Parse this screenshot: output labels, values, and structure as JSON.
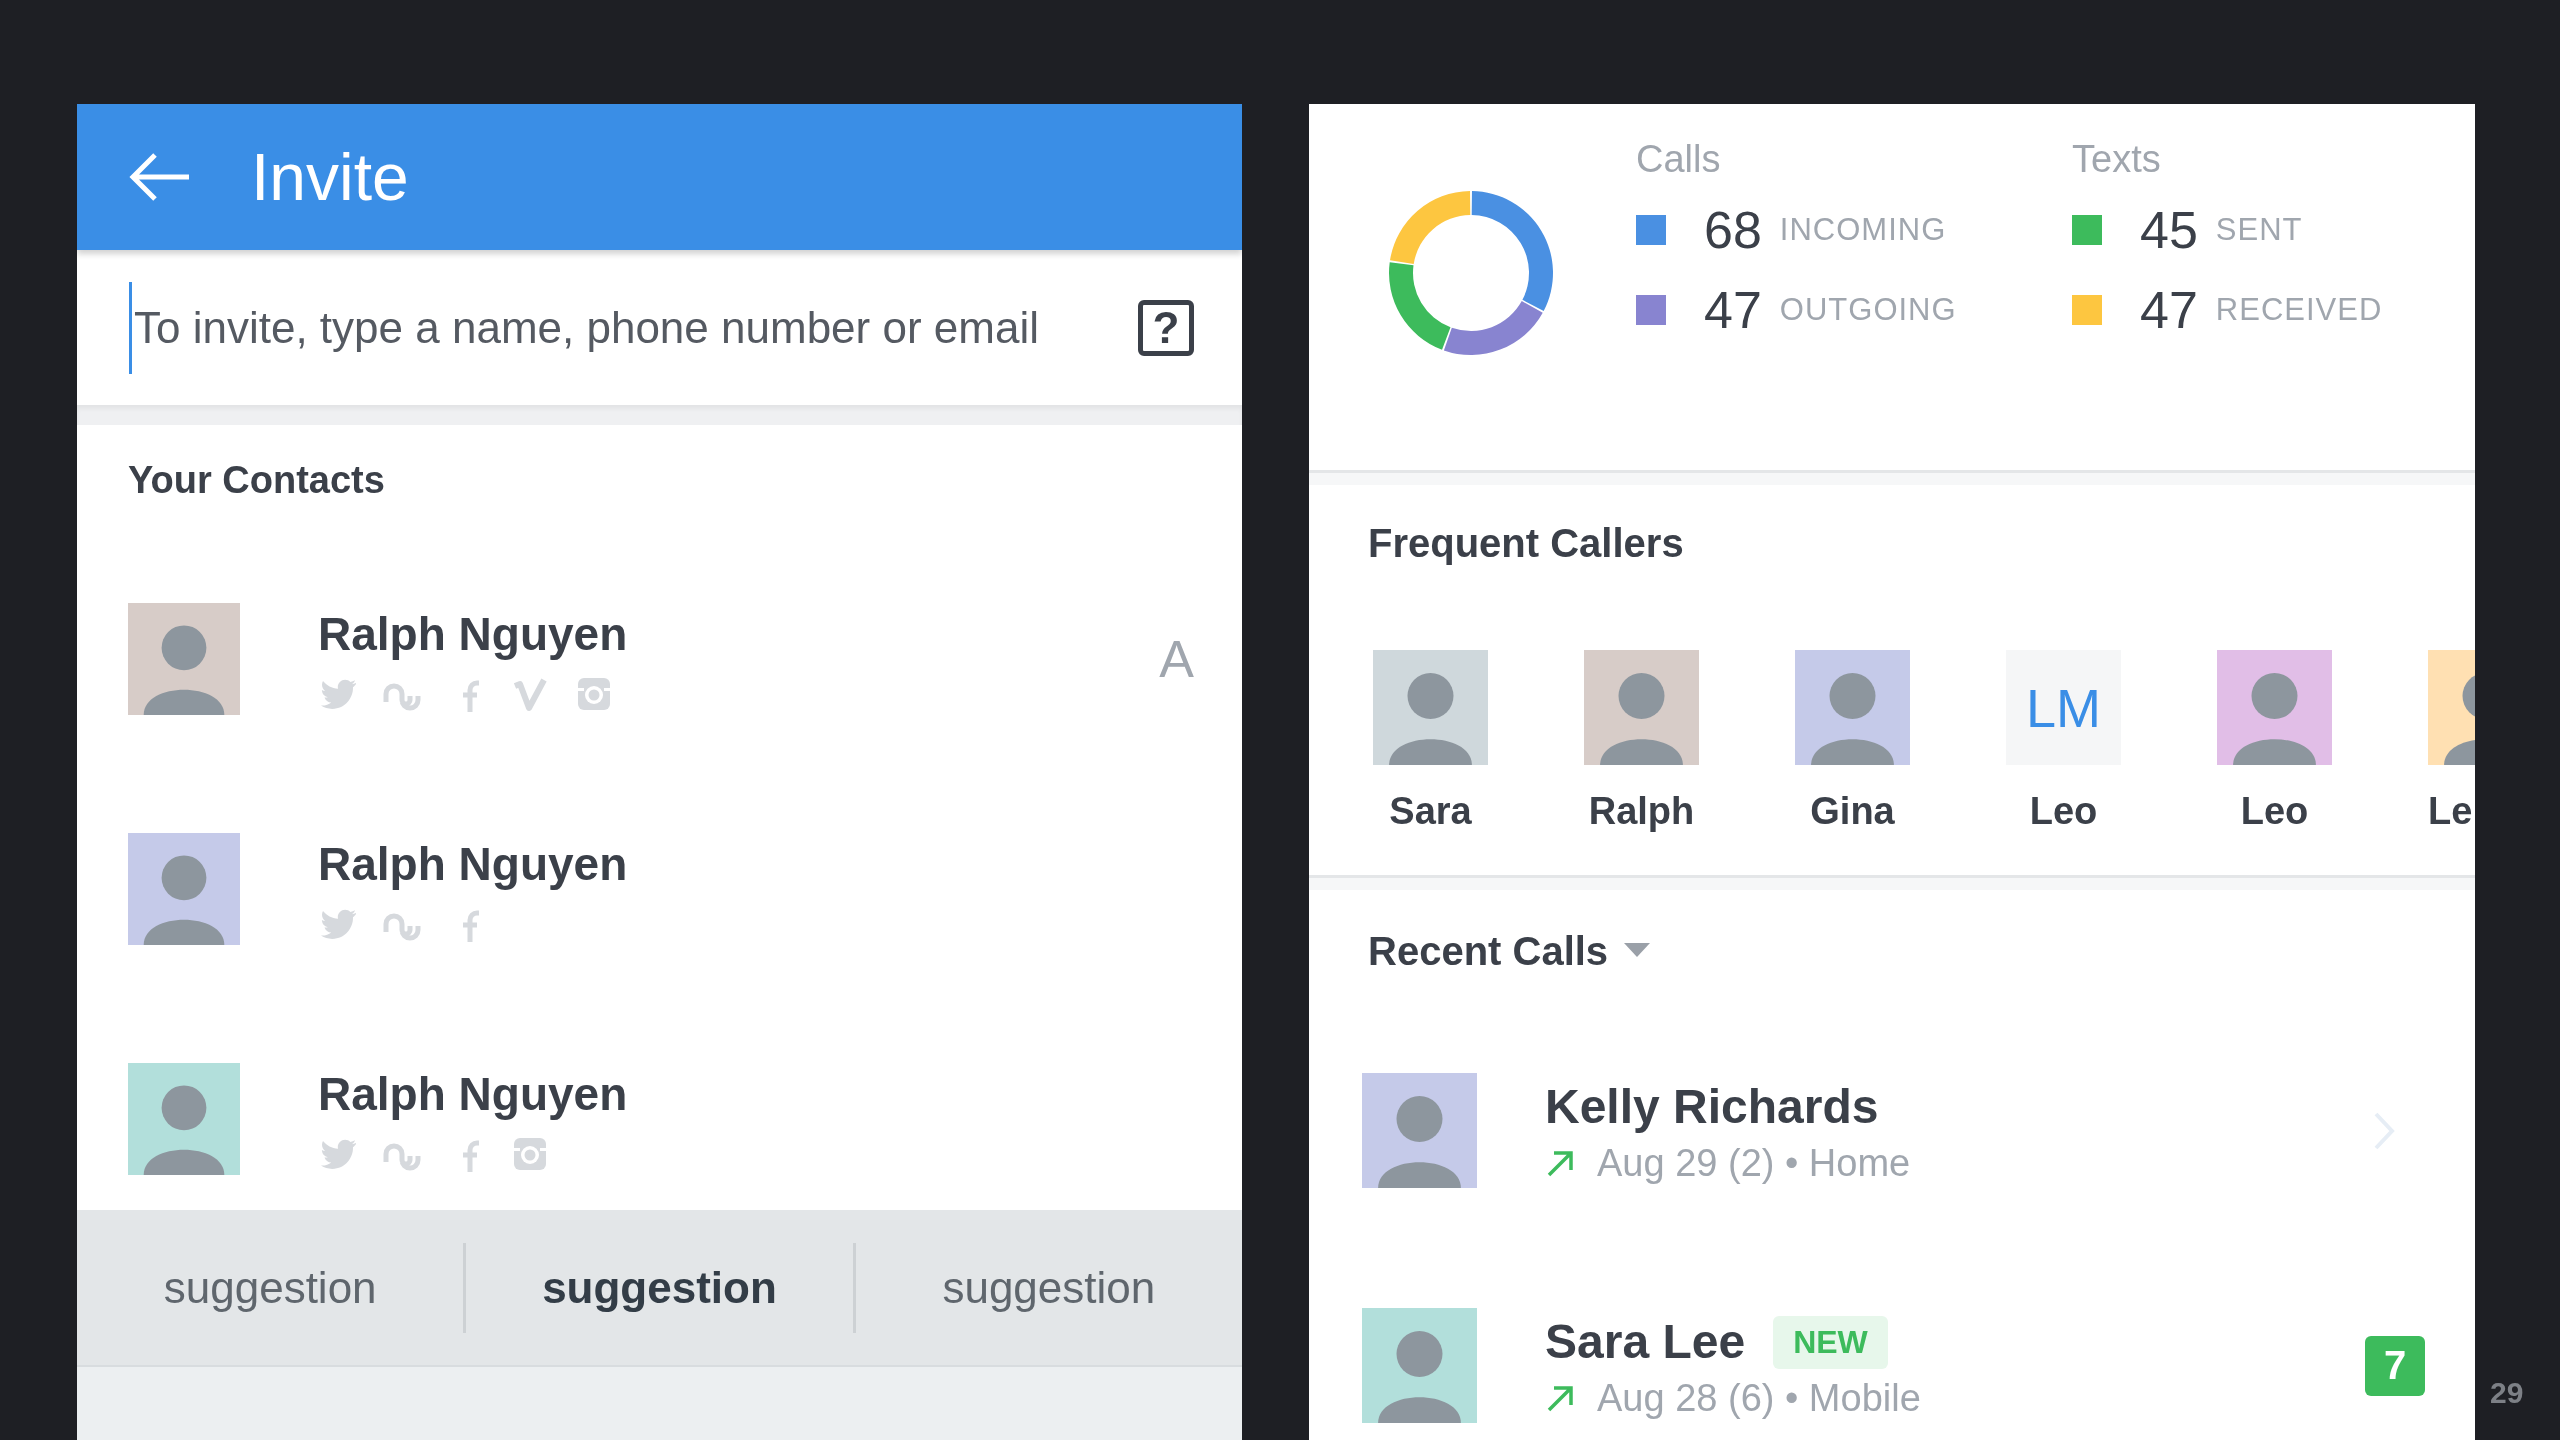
{
  "invite": {
    "title": "Invite",
    "search": {
      "placeholder": "To invite, type a name, phone number or email",
      "help": "?"
    },
    "contacts_heading": "Your Contacts",
    "contacts": [
      {
        "name": "Ralph Nguyen",
        "networks": [
          {
            "kind": "twitter"
          },
          {
            "kind": "stumbleupon"
          },
          {
            "kind": "facebook"
          },
          {
            "kind": "vimeo"
          },
          {
            "kind": "instagram"
          }
        ],
        "index_letter": "A"
      },
      {
        "name": "Ralph Nguyen",
        "networks": [
          {
            "kind": "twitter"
          },
          {
            "kind": "stumbleupon"
          },
          {
            "kind": "facebook"
          }
        ]
      },
      {
        "name": "Ralph Nguyen",
        "networks": [
          {
            "kind": "twitter"
          },
          {
            "kind": "stumbleupon"
          },
          {
            "kind": "facebook"
          },
          {
            "kind": "instagram"
          }
        ]
      }
    ],
    "suggestions": [
      {
        "label": "suggestion",
        "selected": false
      },
      {
        "label": "suggestion",
        "selected": true
      },
      {
        "label": "suggestion",
        "selected": false
      }
    ]
  },
  "stats": {
    "groups": [
      {
        "title": "Calls",
        "items": [
          {
            "count": "68",
            "label": "INCOMING",
            "color": "#4a90e2"
          },
          {
            "count": "47",
            "label": "OUTGOING",
            "color": "#8884d0"
          }
        ]
      },
      {
        "title": "Texts",
        "items": [
          {
            "count": "45",
            "label": "SENT",
            "color": "#3dbb5c"
          },
          {
            "count": "47",
            "label": "RECEIVED",
            "color": "#fdc640"
          }
        ]
      }
    ]
  },
  "frequent_callers": {
    "title": "Frequent Callers",
    "people": [
      {
        "name": "Sara",
        "kind": "photo"
      },
      {
        "name": "Ralph",
        "kind": "photo"
      },
      {
        "name": "Gina",
        "kind": "photo"
      },
      {
        "name": "Leo",
        "kind": "initials",
        "initials": "LM"
      },
      {
        "name": "Leo",
        "kind": "photo"
      },
      {
        "name": "Le",
        "kind": "photo"
      }
    ]
  },
  "recent_calls": {
    "title": "Recent Calls",
    "calls": [
      {
        "name": "Kelly Richards",
        "detail": "Aug 29 (2) • Home",
        "kind": "outgoing",
        "chevron": true
      },
      {
        "name": "Sara Lee",
        "badge": "NEW",
        "detail": "Aug 28 (6) • Mobile",
        "kind": "outgoing",
        "count": "7",
        "chevron": false
      }
    ]
  },
  "page_number": "29"
}
